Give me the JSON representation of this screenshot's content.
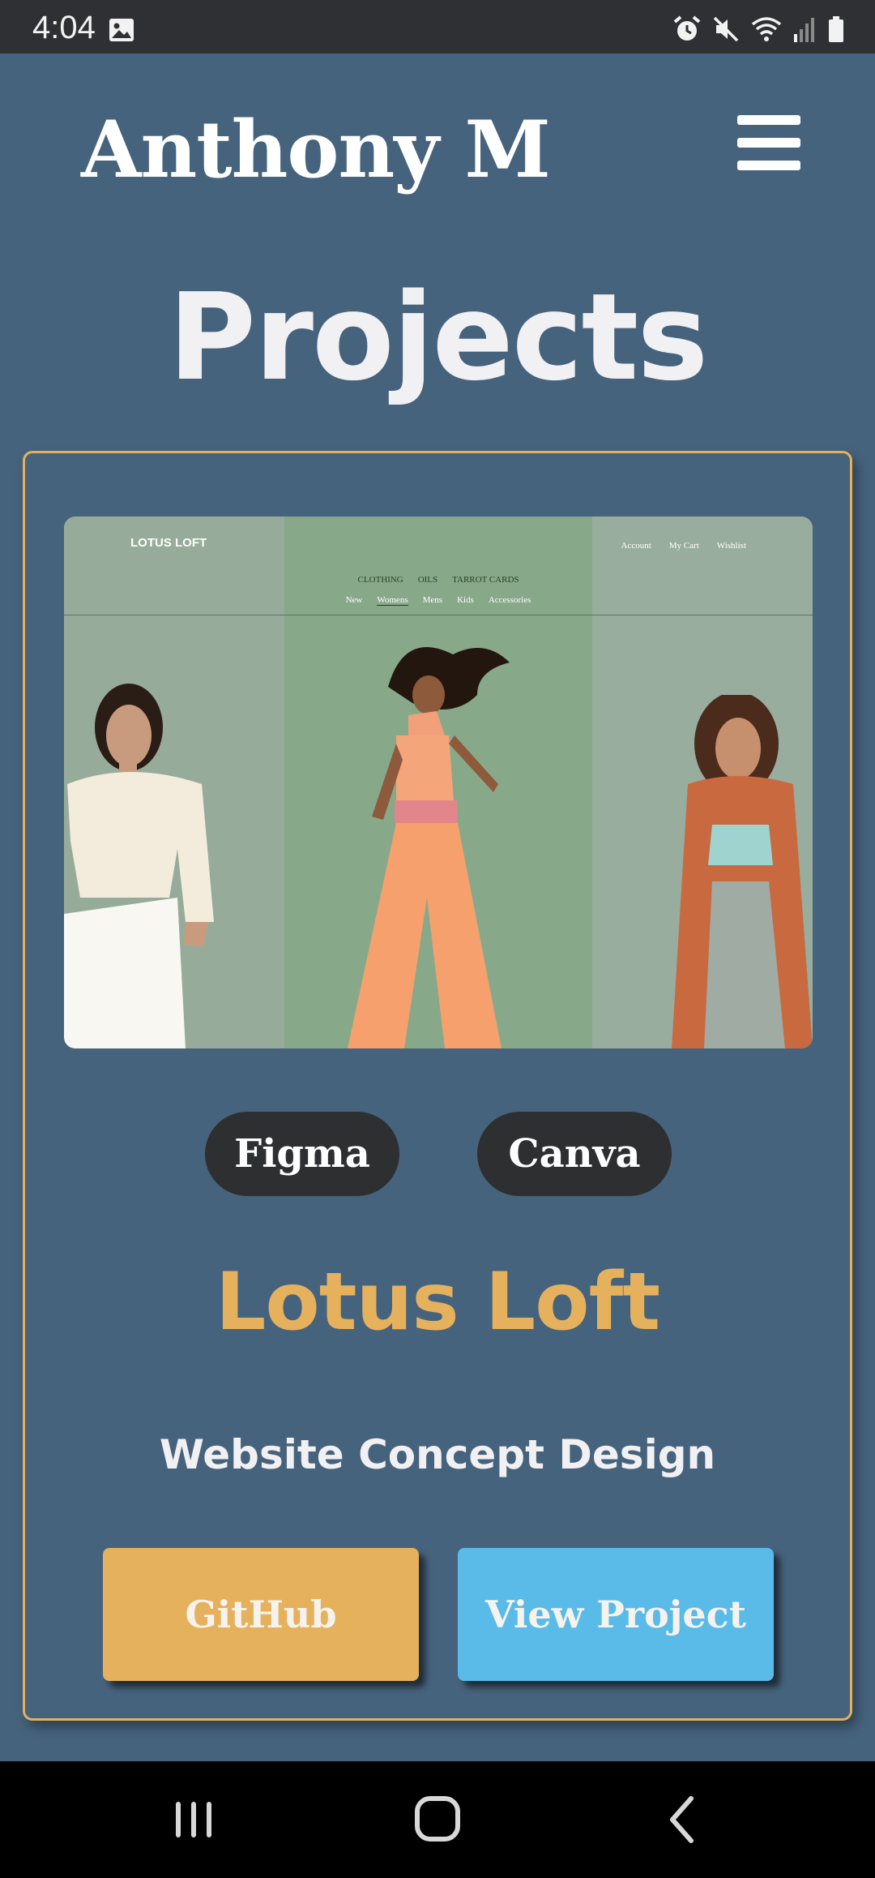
{
  "status_bar": {
    "time": "4:04",
    "icons": [
      "image-icon",
      "alarm-icon",
      "mute-icon",
      "wifi-icon",
      "signal-icon",
      "battery-icon"
    ]
  },
  "header": {
    "brand": "Anthony M",
    "menu_icon": "hamburger-menu-icon"
  },
  "page": {
    "title": "Projects"
  },
  "project": {
    "preview": {
      "logo": "LOTUS LOFT",
      "nav_primary": [
        "CLOTHING",
        "OILS",
        "TARROT CARDS"
      ],
      "nav_secondary": [
        "New",
        "Womens",
        "Mens",
        "Kids",
        "Accessories"
      ],
      "account_links": [
        "Account",
        "My Cart",
        "Wishlist"
      ]
    },
    "tags": [
      "Figma",
      "Canva"
    ],
    "title": "Lotus Loft",
    "subtitle": "Website Concept Design",
    "buttons": {
      "github": "GitHub",
      "view": "View Project"
    }
  },
  "colors": {
    "background": "#46637d",
    "accent_gold": "#e6b15c",
    "accent_blue": "#5bbbe8",
    "tag_bg": "#2e2f31"
  },
  "nav_bar": {
    "icons": [
      "recent-apps-icon",
      "home-icon",
      "back-icon"
    ]
  }
}
